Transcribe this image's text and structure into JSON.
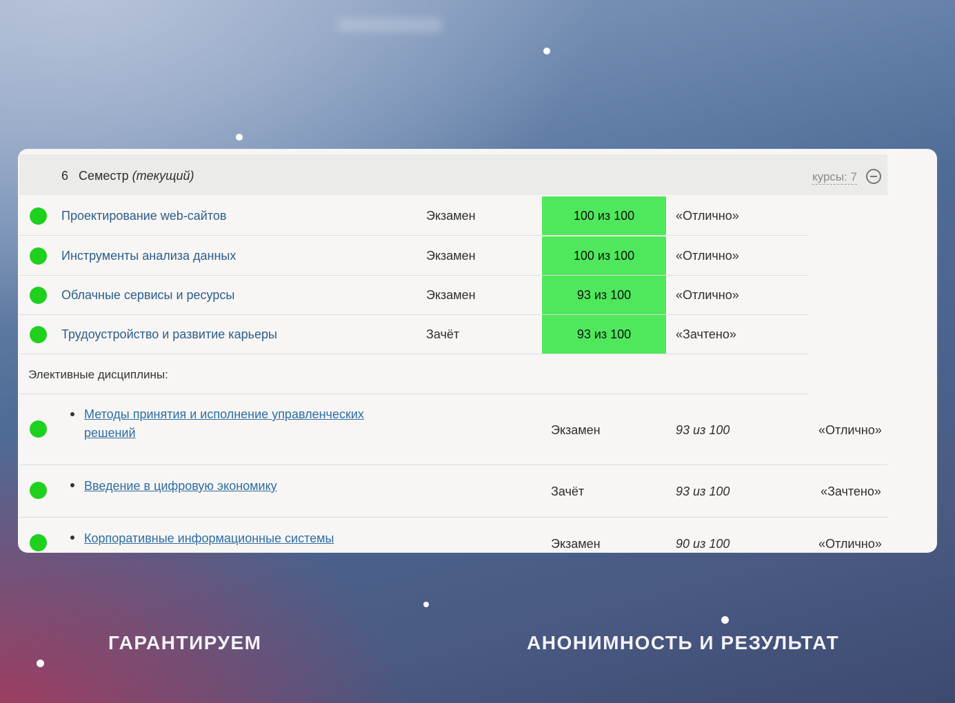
{
  "header": {
    "semester_number": "6",
    "semester_label": "Семестр",
    "semester_status": "(текущий)",
    "courses_toggle": "курсы: 7",
    "collapse_icon": "minus-circle-icon"
  },
  "courses": [
    {
      "name": "Проектирование web-сайтов",
      "control": "Экзамен",
      "score": "100 из 100",
      "grade": "«Отлично»",
      "status_icon": "green-status-dot"
    },
    {
      "name": "Инструменты анализа данных",
      "control": "Экзамен",
      "score": "100 из 100",
      "grade": "«Отлично»",
      "status_icon": "green-status-dot"
    },
    {
      "name": "Облачные сервисы и ресурсы",
      "control": "Экзамен",
      "score": "93 из 100",
      "grade": "«Отлично»",
      "status_icon": "green-status-dot"
    },
    {
      "name": "Трудоустройство и развитие карьеры",
      "control": "Зачёт",
      "score": "93 из 100",
      "grade": "«Зачтено»",
      "status_icon": "green-status-dot"
    }
  ],
  "electives": {
    "heading": "Элективные дисциплины:",
    "items": [
      {
        "name": "Методы принятия и исполнение управленческих решений",
        "control": "Экзамен",
        "score": "93 из 100",
        "grade": "«Отлично»",
        "status_icon": "green-status-dot"
      },
      {
        "name": "Введение в цифровую экономику",
        "control": "Зачёт",
        "score": "93 из 100",
        "grade": "«Зачтено»",
        "status_icon": "green-status-dot"
      },
      {
        "name": "Корпоративные информационные системы",
        "control": "Экзамен",
        "score": "90 из 100",
        "grade": "«Отлично»",
        "status_icon": "green-status-dot"
      }
    ]
  },
  "tagline": {
    "left": "ГАРАНТИРУЕМ",
    "right": "АНОНИМНОСТЬ И РЕЗУЛЬТАТ"
  },
  "colors": {
    "status_dot": "#1fd01f",
    "score_cell": "#4fe85c",
    "course_link": "#2c5d8c",
    "elective_link": "#2e6ca3",
    "header_band": "#ebebea"
  }
}
